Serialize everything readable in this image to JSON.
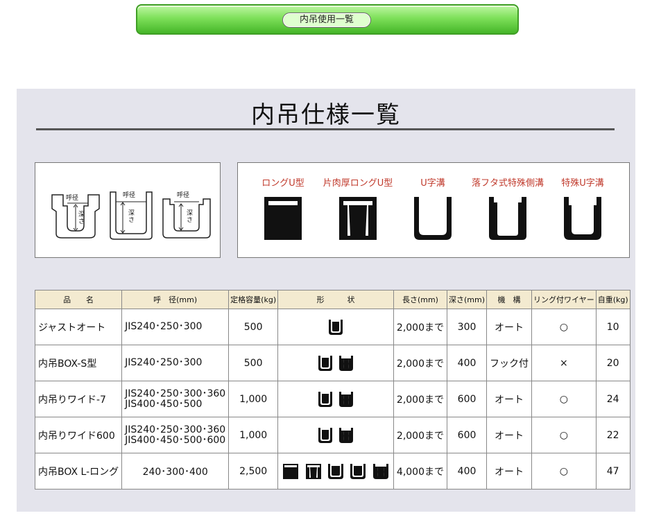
{
  "banner": {
    "label": "内吊使用一覧"
  },
  "title": "内吊仕様一覧",
  "diagram": {
    "bore_label": "呼径",
    "depth_label": "深さ"
  },
  "shapes": [
    {
      "id": "long-u",
      "name": "ロングU型"
    },
    {
      "id": "half-long-u",
      "name": "片肉厚ロングU型"
    },
    {
      "id": "u-groove",
      "name": "U字溝"
    },
    {
      "id": "special-side",
      "name": "落フタ式特殊側溝"
    },
    {
      "id": "special-u",
      "name": "特殊U字溝"
    }
  ],
  "table": {
    "headers": {
      "name": "品　　名",
      "bore": "呼　径(mm)",
      "capacity": "定格容量(kg)",
      "shape": "形　　　状",
      "length": "長さ(mm)",
      "depth": "深さ(mm)",
      "mechanism": "機　構",
      "ring": "リング付ワイヤー",
      "weight": "自重(kg)"
    },
    "rows": [
      {
        "name": "ジャストオート",
        "bore": "JIS240･250･300",
        "bore2": "",
        "capacity": "500",
        "length": "2,000まで",
        "depth": "300",
        "mechanism": "オート",
        "ring": "○",
        "weight": "10"
      },
      {
        "name": "内吊BOX-S型",
        "bore": "JIS240･250･300",
        "bore2": "",
        "capacity": "500",
        "length": "2,000まで",
        "depth": "400",
        "mechanism": "フック付",
        "ring": "×",
        "weight": "20"
      },
      {
        "name": "内吊りワイド-7",
        "bore": "JIS240･250･300･360",
        "bore2": "JIS400･450･500",
        "capacity": "1,000",
        "length": "2,000まで",
        "depth": "600",
        "mechanism": "オート",
        "ring": "○",
        "weight": "24"
      },
      {
        "name": "内吊りワイド600",
        "bore": "JIS240･250･300･360",
        "bore2": "JIS400･450･500･600",
        "capacity": "1,000",
        "length": "2,000まで",
        "depth": "600",
        "mechanism": "オート",
        "ring": "○",
        "weight": "22"
      },
      {
        "name": "内吊BOX L-ロング",
        "bore": "240･300･400",
        "bore2": "",
        "capacity": "2,500",
        "length": "4,000まで",
        "depth": "400",
        "mechanism": "オート",
        "ring": "○",
        "weight": "47"
      }
    ]
  }
}
